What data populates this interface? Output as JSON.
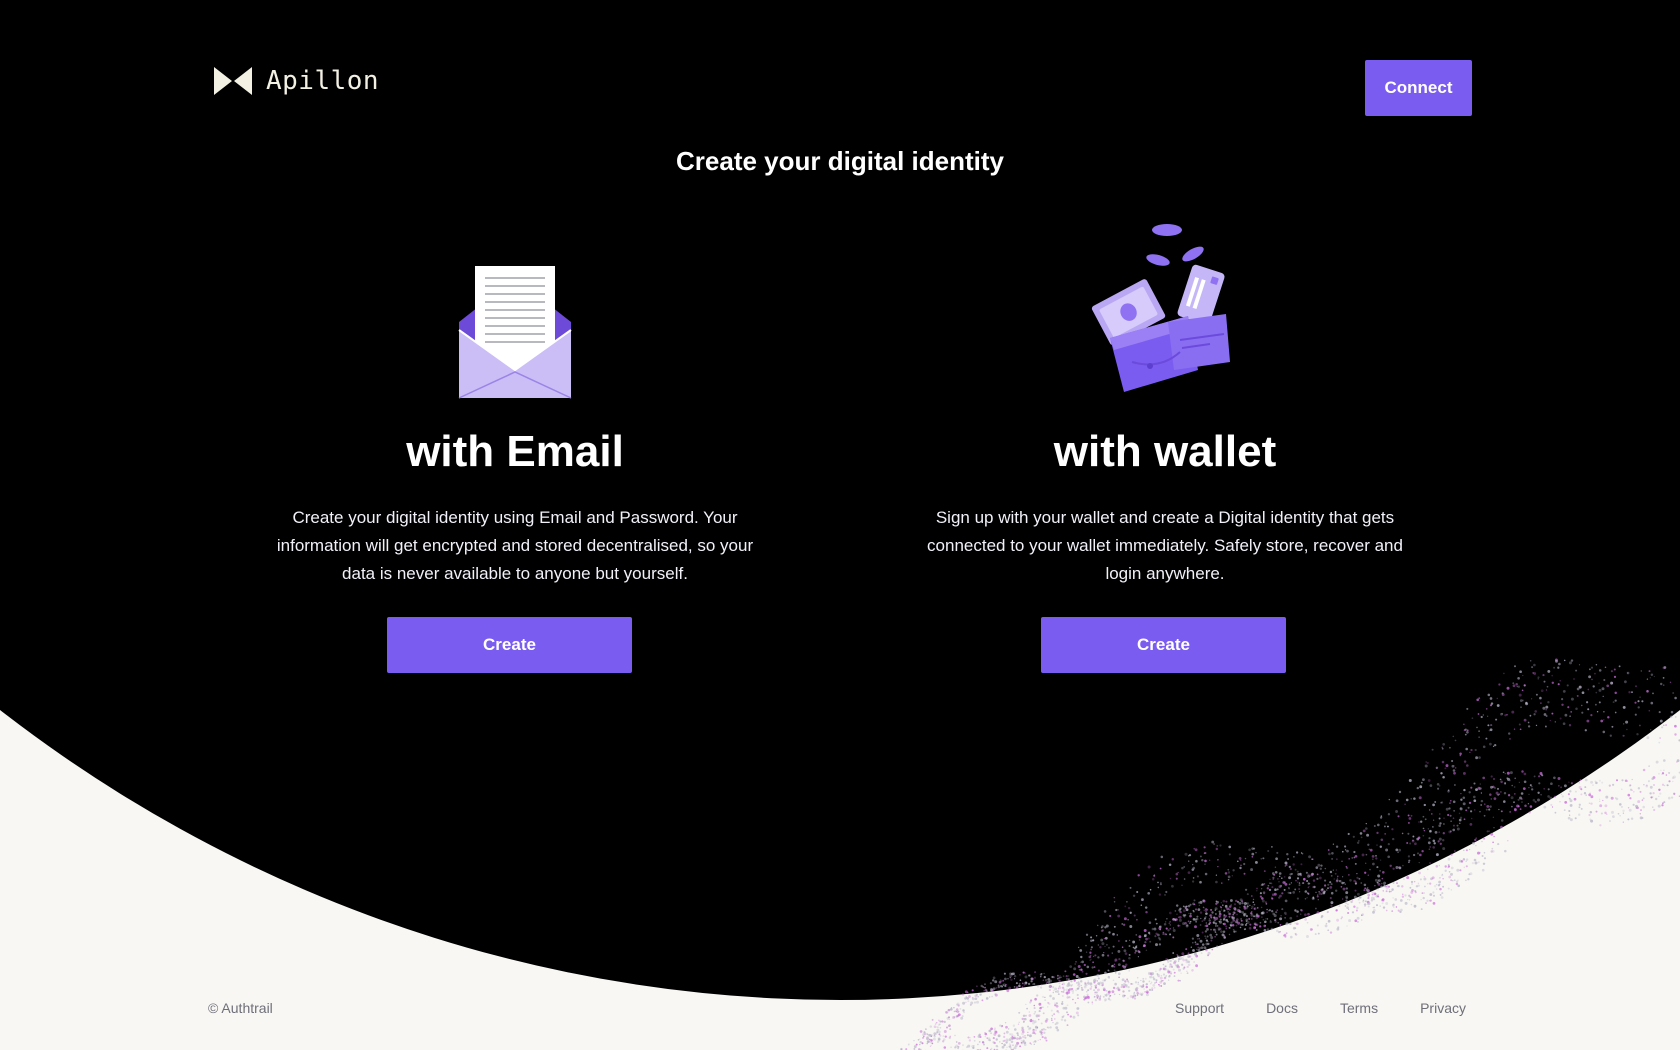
{
  "brand": {
    "name": "Apillon"
  },
  "header": {
    "connect_label": "Connect"
  },
  "headline": "Create your digital identity",
  "cards": [
    {
      "title": "with Email",
      "description": "Create your digital identity using Email and Password. Your information will get encrypted and stored decentralised, so your data is never available to anyone but yourself.",
      "button_label": "Create",
      "icon": "envelope-letter-icon"
    },
    {
      "title": "with wallet",
      "description": "Sign up with your wallet and create a Digital identity that gets connected to your wallet immediately. Safely store, recover and login anywhere.",
      "button_label": "Create",
      "icon": "wallet-icon"
    }
  ],
  "footer": {
    "copyright": "© Authtrail",
    "links": [
      "Support",
      "Docs",
      "Terms",
      "Privacy"
    ]
  },
  "colors": {
    "accent": "#7b5cf0",
    "background_dark": "#000000",
    "background_light": "#f8f7f3",
    "logo": "#f3f1e4"
  }
}
